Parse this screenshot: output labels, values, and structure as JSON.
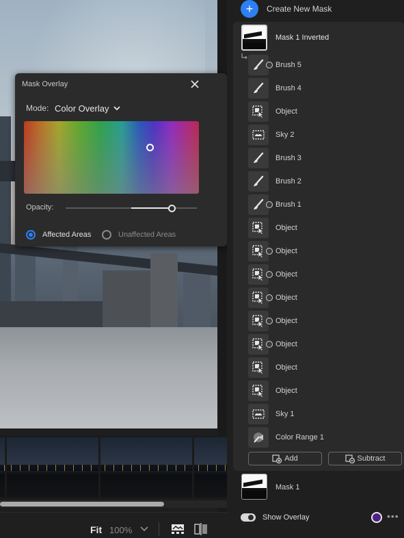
{
  "overlay_panel": {
    "title": "Mask Overlay",
    "mode_label": "Mode:",
    "mode_value": "Color Overlay",
    "opacity_label": "Opacity:",
    "opacity_value": 0.9,
    "radio_affected": "Affected Areas",
    "radio_unaffected": "Unaffected Areas",
    "selected_area": "Affected Areas"
  },
  "masks_panel": {
    "create_label": "Create New Mask",
    "mask_group_name": "Mask 1 Inverted",
    "components": [
      {
        "label": "Brush 5",
        "icon": "brush-icon",
        "subtract": true
      },
      {
        "label": "Brush 4",
        "icon": "brush-icon",
        "subtract": false
      },
      {
        "label": "Object",
        "icon": "object-select-icon",
        "subtract": false
      },
      {
        "label": "Sky 2",
        "icon": "sky-icon",
        "subtract": false
      },
      {
        "label": "Brush 3",
        "icon": "brush-icon",
        "subtract": false
      },
      {
        "label": "Brush 2",
        "icon": "brush-icon",
        "subtract": false
      },
      {
        "label": "Brush 1",
        "icon": "brush-icon",
        "subtract": true
      },
      {
        "label": "Object",
        "icon": "object-select-icon",
        "subtract": false
      },
      {
        "label": "Object",
        "icon": "object-select-icon",
        "subtract": true
      },
      {
        "label": "Object",
        "icon": "object-select-icon",
        "subtract": true
      },
      {
        "label": "Object",
        "icon": "object-select-icon",
        "subtract": true
      },
      {
        "label": "Object",
        "icon": "object-select-icon",
        "subtract": true
      },
      {
        "label": "Object",
        "icon": "object-select-icon",
        "subtract": true
      },
      {
        "label": "Object",
        "icon": "object-select-icon",
        "subtract": false
      },
      {
        "label": "Object",
        "icon": "object-select-icon",
        "subtract": false
      },
      {
        "label": "Sky 1",
        "icon": "sky-icon",
        "subtract": false
      },
      {
        "label": "Color Range 1",
        "icon": "color-range-icon",
        "subtract": false
      }
    ],
    "add_label": "Add",
    "subtract_label": "Subtract",
    "mask_1_name": "Mask 1",
    "show_overlay_label": "Show Overlay",
    "show_overlay_on": true,
    "overlay_color": "#4e1f86",
    "more_label": "•••"
  },
  "toolbar": {
    "fit_label": "Fit",
    "zoom_value": "100%"
  },
  "colors": {
    "accent": "#2e80f2",
    "panel_bg": "#2a2a2a"
  }
}
